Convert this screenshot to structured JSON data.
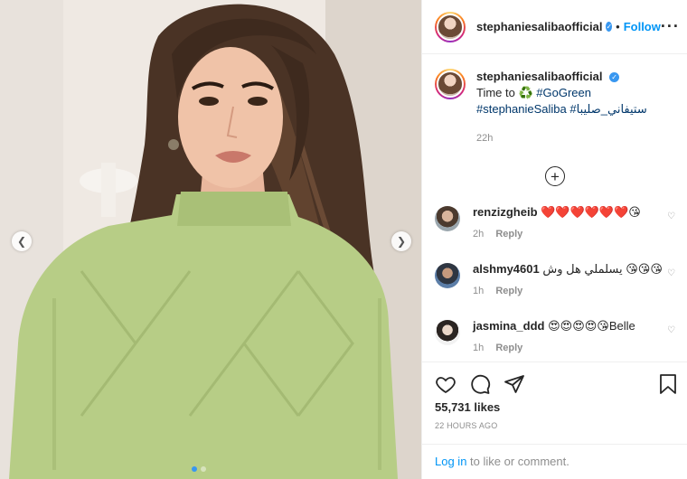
{
  "post": {
    "username": "stephaniesalibaofficial",
    "follow_label": "Follow",
    "bullet": "•",
    "caption_prefix": "Time to ♻️ ",
    "hashtag_1": "#GoGreen",
    "hashtag_2": "#stephanieSaliba",
    "hashtag_3": "#ستيفاني_صليبا",
    "caption_time": "22h",
    "load_more": "+"
  },
  "comments": [
    {
      "username": "renzizgheib",
      "text": "❤️❤️❤️❤️❤️❤️😘",
      "time": "2h",
      "reply": "Reply"
    },
    {
      "username": "alshmy4601",
      "text": "يسلملي هل وش 😘😘😘",
      "time": "1h",
      "reply": "Reply"
    },
    {
      "username": "jasmina_ddd",
      "text": "😍😍😍😍😘Belle",
      "time": "1h",
      "reply": "Reply"
    }
  ],
  "footer": {
    "likes": "55,731 likes",
    "posted": "22 HOURS AGO",
    "login_label": "Log in",
    "login_suffix": " to like or comment."
  },
  "icons": {
    "like": "heart-icon",
    "comment": "comment-icon",
    "share": "share-icon",
    "save": "bookmark-icon",
    "more": "more-icon",
    "prev": "chevron-left-icon",
    "next": "chevron-right-icon"
  },
  "colors": {
    "accent": "#0095f6",
    "text": "#262626",
    "muted": "#8e8e8e",
    "sweater": "#b7cd86",
    "hair": "#4a3325"
  },
  "carousel": {
    "total": 2,
    "active": 1
  }
}
